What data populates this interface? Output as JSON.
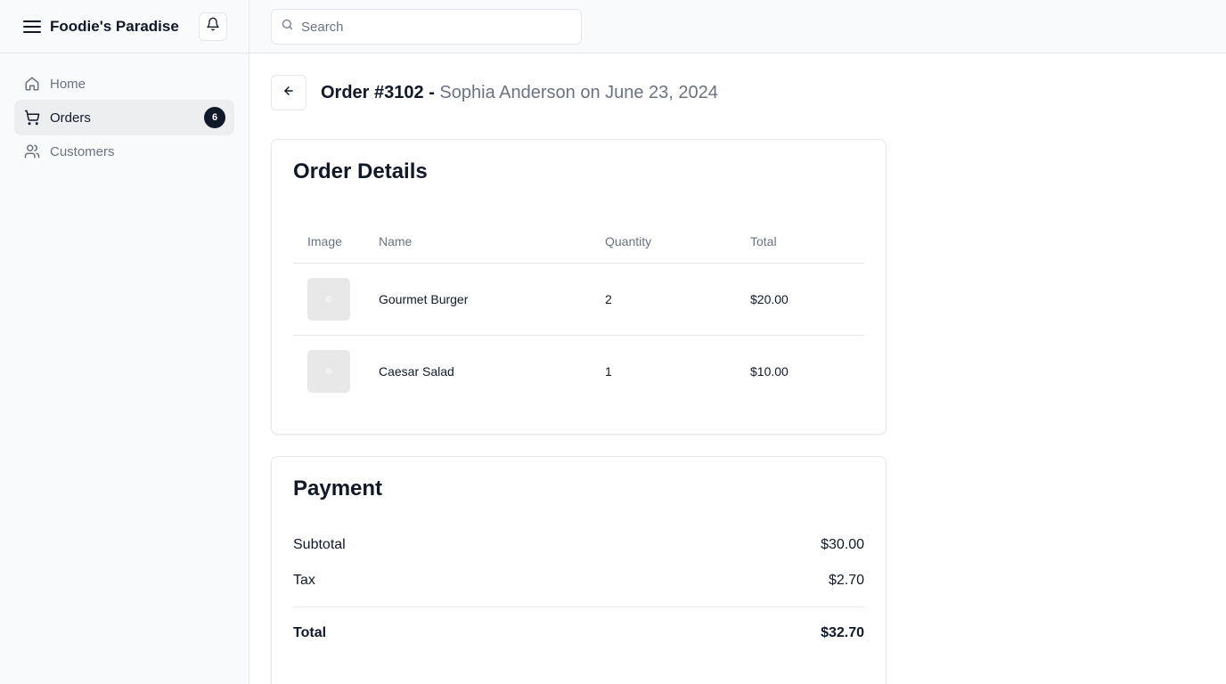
{
  "sidebar": {
    "brand": "Foodie's Paradise",
    "nav": [
      {
        "label": "Home",
        "icon": "home-icon"
      },
      {
        "label": "Orders",
        "icon": "cart-icon",
        "badge": "6",
        "active": true
      },
      {
        "label": "Customers",
        "icon": "users-icon"
      }
    ]
  },
  "topbar": {
    "search_placeholder": "Search"
  },
  "page": {
    "order_number": "Order #3102 -",
    "subtitle": "Sophia Anderson on June 23, 2024"
  },
  "order_details": {
    "title": "Order Details",
    "columns": [
      "Image",
      "Name",
      "Quantity",
      "Total"
    ],
    "items": [
      {
        "name": "Gourmet Burger",
        "quantity": "2",
        "total": "$20.00"
      },
      {
        "name": "Caesar Salad",
        "quantity": "1",
        "total": "$10.00"
      }
    ]
  },
  "payment": {
    "title": "Payment",
    "rows": [
      {
        "label": "Subtotal",
        "value": "$30.00"
      },
      {
        "label": "Tax",
        "value": "$2.70"
      }
    ],
    "total_label": "Total",
    "total_value": "$32.70"
  },
  "colors": {
    "sidebar_bg": "#f9fafb",
    "active_nav_bg": "#eceef0",
    "badge_bg": "#111827",
    "muted_text": "#6b7280",
    "border": "#e5e7eb"
  }
}
